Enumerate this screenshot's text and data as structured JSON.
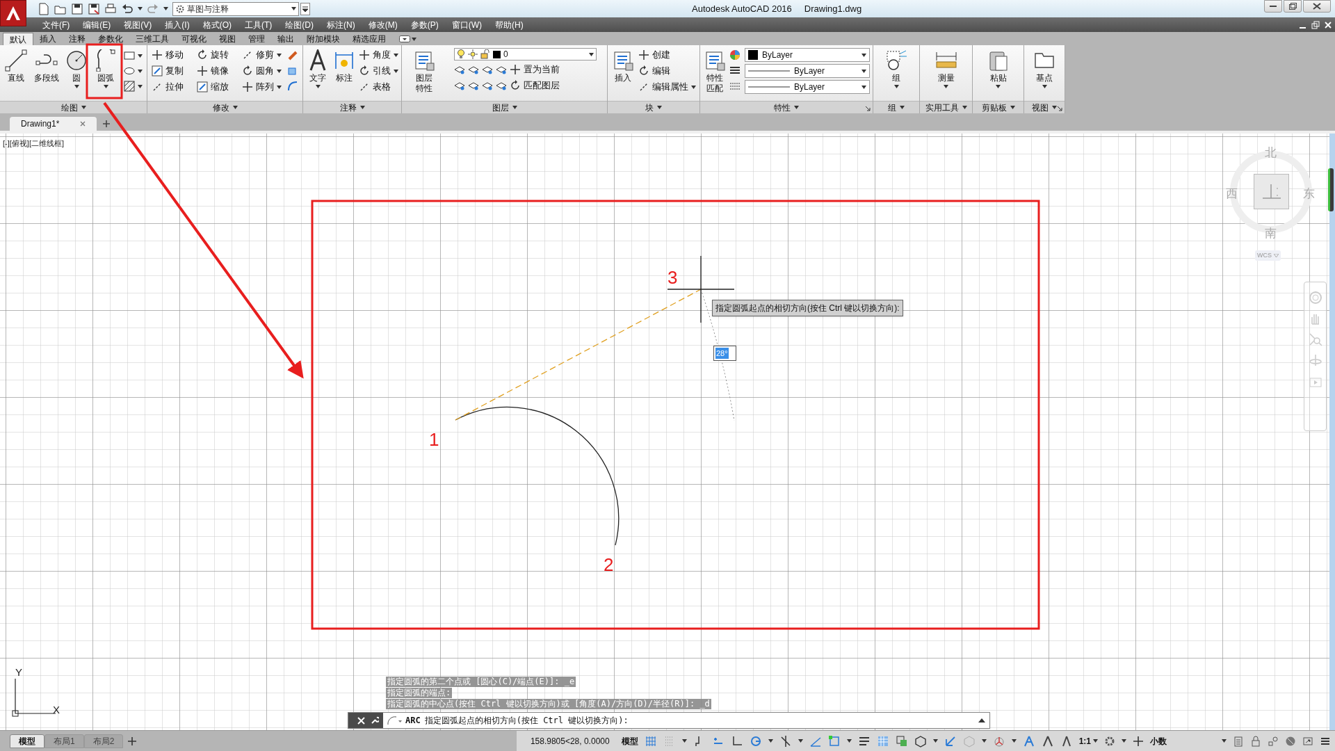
{
  "window": {
    "title": "Autodesk AutoCAD 2016",
    "document": "Drawing1.dwg"
  },
  "quick_access": {
    "workspace": "草图与注释"
  },
  "menu_bar": [
    "文件(F)",
    "编辑(E)",
    "视图(V)",
    "插入(I)",
    "格式(O)",
    "工具(T)",
    "绘图(D)",
    "标注(N)",
    "修改(M)",
    "参数(P)",
    "窗口(W)",
    "帮助(H)"
  ],
  "ribbon_tabs": [
    {
      "label": "默认",
      "selected": true
    },
    {
      "label": "插入",
      "selected": false
    },
    {
      "label": "注释",
      "selected": false
    },
    {
      "label": "参数化",
      "selected": false
    },
    {
      "label": "三维工具",
      "selected": false
    },
    {
      "label": "可视化",
      "selected": false
    },
    {
      "label": "视图",
      "selected": false
    },
    {
      "label": "管理",
      "selected": false
    },
    {
      "label": "输出",
      "selected": false
    },
    {
      "label": "附加模块",
      "selected": false
    },
    {
      "label": "精选应用",
      "selected": false
    }
  ],
  "ribbon_panels": [
    {
      "title": "绘图",
      "large": [
        "直线",
        "多段线",
        "圆",
        "圆弧"
      ]
    },
    {
      "title": "修改",
      "small": [
        "移动",
        "旋转",
        "修剪",
        "复制",
        "镜像",
        "圆角",
        "拉伸",
        "缩放",
        "阵列"
      ]
    },
    {
      "title": "注释",
      "large": [
        "文字",
        "标注"
      ],
      "small": [
        "角度",
        "引线",
        "表格"
      ]
    },
    {
      "title": "图层",
      "large": [
        "图层特性"
      ],
      "layer": "0",
      "small": [
        "置为当前",
        "匹配图层"
      ]
    },
    {
      "title": "块",
      "large": [
        "插入"
      ],
      "small": [
        "创建",
        "编辑",
        "编辑属性"
      ]
    },
    {
      "title": "特性",
      "large": [
        "特性匹配"
      ],
      "dropdowns": [
        "ByLayer",
        "ByLayer",
        "ByLayer"
      ]
    },
    {
      "title": "组",
      "large": [
        "组"
      ]
    },
    {
      "title": "实用工具",
      "large": [
        "测量"
      ]
    },
    {
      "title": "剪贴板",
      "large": [
        "粘贴"
      ]
    },
    {
      "title": "视图",
      "large": [
        "基点"
      ]
    }
  ],
  "drawing_tabs": [
    {
      "label": "Drawing1*",
      "selected": true
    }
  ],
  "viewport": {
    "label": "[-][俯视][二维线框]",
    "point_labels": [
      "1",
      "2",
      "3"
    ],
    "tooltip": "指定圆弧起点的相切方向(按住 Ctrl 键以切换方向):",
    "angle_input": "28°",
    "viewcube": {
      "north": "北",
      "west": "西",
      "east": "东",
      "south": "南",
      "coordinate_system": "WCS"
    },
    "ucs": {
      "y": "Y",
      "x": "X"
    }
  },
  "command_history": [
    "指定圆弧的第二个点或 [圆心(C)/端点(E)]: _e",
    "指定圆弧的端点:",
    "指定圆弧的中心点(按住 Ctrl 键以切换方向)或 [角度(A)/方向(D)/半径(R)]: _d"
  ],
  "command_line": {
    "command": "ARC",
    "prompt": "指定圆弧起点的相切方向(按住 Ctrl 键以切换方向):"
  },
  "layout_tabs": [
    {
      "label": "模型",
      "selected": true
    },
    {
      "label": "布局1",
      "selected": false
    },
    {
      "label": "布局2",
      "selected": false
    }
  ],
  "status_bar": {
    "coordinates": "158.9805<28, 0.0000",
    "space": "模型",
    "scale": "1:1",
    "units": "小数"
  }
}
